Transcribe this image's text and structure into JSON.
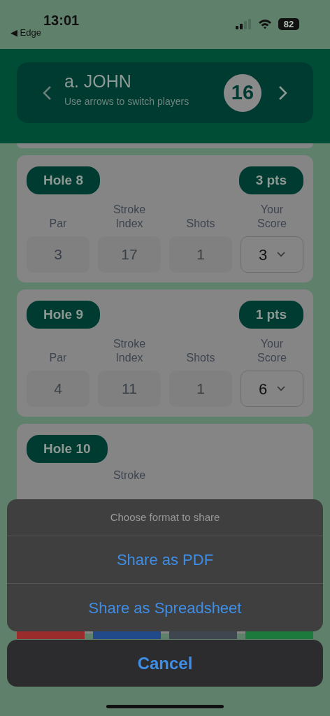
{
  "status_bar": {
    "time": "13:01",
    "back_app": "◀ Edge",
    "battery": "82"
  },
  "player": {
    "name": "a. JOHN",
    "hint": "Use arrows to switch players",
    "total": "16"
  },
  "holes": [
    {
      "badge": "Hole 8",
      "points": "3 pts",
      "labels": [
        "Par",
        "Stroke Index",
        "Shots",
        "Your Score"
      ],
      "par": "3",
      "stroke_index": "17",
      "shots": "1",
      "score": "3"
    },
    {
      "badge": "Hole 9",
      "points": "1 pts",
      "labels": [
        "Par",
        "Stroke Index",
        "Shots",
        "Your Score"
      ],
      "par": "4",
      "stroke_index": "11",
      "shots": "1",
      "score": "6"
    },
    {
      "badge": "Hole 10",
      "second_label": "Stroke"
    }
  ],
  "bottom_buttons": [
    {
      "color": "#9b2c2c"
    },
    {
      "color": "#214a8a"
    },
    {
      "color": "#3f4650"
    },
    {
      "color": "#1b7a3c"
    }
  ],
  "action_sheet": {
    "title": "Choose format to share",
    "actions": [
      "Share as PDF",
      "Share as Spreadsheet"
    ],
    "cancel": "Cancel"
  }
}
